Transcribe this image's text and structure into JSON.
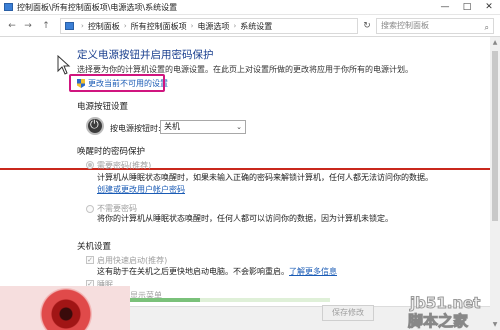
{
  "window": {
    "title": "控制面板\\所有控制面板项\\电源选项\\系统设置",
    "minimize": "—",
    "maximize": "□",
    "close": "✕"
  },
  "address": {
    "back": "←",
    "forward": "→",
    "up": "↑",
    "crumbs": [
      "控制面板",
      "所有控制面板项",
      "电源选项",
      "系统设置"
    ],
    "separator": "›",
    "refresh": "↻",
    "search_placeholder": "搜索控制面板"
  },
  "main": {
    "heading": "定义电源按钮并启用密码保护",
    "description": "选择要为你的计算机设置的电源设置。在此页上对设置所做的更改将应用于你所有的电源计划。",
    "change_link": "更改当前不可用的设置"
  },
  "power_button": {
    "section_title": "电源按钮设置",
    "label": "按电源按钮时:",
    "value": "关机"
  },
  "wake_password": {
    "section_title": "唤醒时的密码保护",
    "option1_label": "需要密码(推荐)",
    "option1_desc": "计算机从睡眠状态唤醒时，如果未输入正确的密码来解锁计算机，任何人都无法访问你的数据。",
    "option1_link": "创建或更改用户帐户密码",
    "option2_label": "不需要密码",
    "option2_desc": "将你的计算机从睡眠状态唤醒时，任何人都可以访问你的数据，因为计算机未锁定。"
  },
  "shutdown": {
    "section_title": "关机设置",
    "fast_startup_label": "启用快速启动(推荐)",
    "fast_startup_desc": "这有助于在关机之后更快地启动电脑。不会影响重启。",
    "learn_more": "了解更多信息",
    "sleep_label": "睡眠",
    "lock_label": "显示菜单"
  },
  "footer": {
    "save_label": "保存修改",
    "progress_percent": 35
  },
  "watermark": {
    "site": "jb51.net",
    "name": "脚本之家"
  },
  "colors": {
    "heading": "#1a3f8f",
    "link": "#1a5bb5",
    "highlight": "#d0157f",
    "rule": "#c9281c"
  }
}
